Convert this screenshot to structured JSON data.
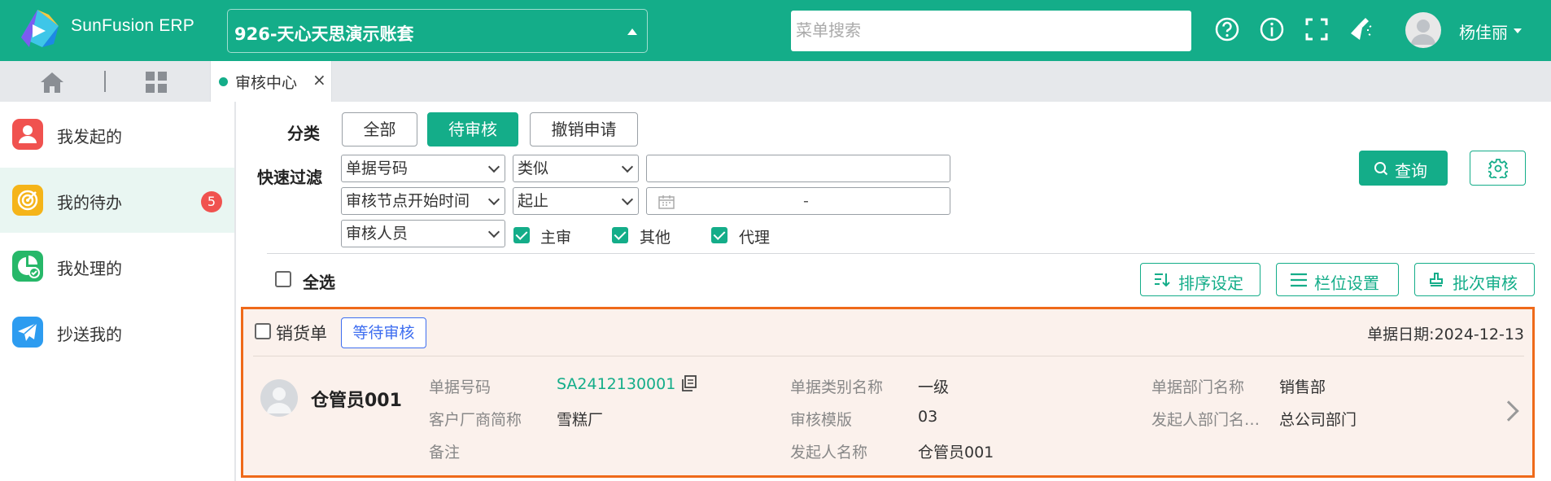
{
  "app": {
    "logo_text": "SunFusion ERP",
    "account": "926-天心天思演示账套",
    "search_placeholder": "菜单搜索",
    "user_name": "杨佳丽",
    "brand_color": "#14ad89"
  },
  "toolbar_icons": [
    "help-icon",
    "info-icon",
    "fullscreen-icon",
    "clean-icon"
  ],
  "tabs": {
    "home_icon": "home-icon",
    "grid_icon": "apps-grid-icon",
    "active_tab": "审核中心"
  },
  "sidebar": {
    "items": [
      {
        "label": "我发起的",
        "icon": "person-icon",
        "color": "#f0524f"
      },
      {
        "label": "我的待办",
        "icon": "target-icon",
        "color": "#f5b419",
        "badge": "5"
      },
      {
        "label": "我处理的",
        "icon": "chart-check-icon",
        "color": "#27b869"
      },
      {
        "label": "抄送我的",
        "icon": "send-icon",
        "color": "#2d9cf0"
      }
    ]
  },
  "filters": {
    "category_label": "分类",
    "categories": [
      "全部",
      "待审核",
      "撤销申请"
    ],
    "active_category": "待审核",
    "quick_label": "快速过滤",
    "row1": {
      "field": "单据号码",
      "op": "类似",
      "value": ""
    },
    "row2": {
      "field": "审核节点开始时间",
      "op": "起止",
      "range_sep": "-"
    },
    "row3": {
      "field": "审核人员"
    },
    "checkboxes": [
      {
        "label": "主审",
        "checked": true
      },
      {
        "label": "其他",
        "checked": true
      },
      {
        "label": "代理",
        "checked": true
      }
    ],
    "query_label": "查询"
  },
  "list_toolbar": {
    "select_all": "全选",
    "sort_label": "排序设定",
    "column_label": "栏位设置",
    "batch_label": "批次审核"
  },
  "card": {
    "doc_type": "销货单",
    "status": "等待审核",
    "doc_date": "单据日期:2024-12-13",
    "user": "仓管员001",
    "fields": {
      "doc_no_label": "单据号码",
      "doc_no": "SA2412130001",
      "customer_label": "客户厂商简称",
      "customer": "雪糕厂",
      "remark_label": "备注",
      "remark": "",
      "category_label": "单据类别名称",
      "category": "一级",
      "template_label": "审核模版",
      "template": "03",
      "initiator_label": "发起人名称",
      "initiator": "仓管员001",
      "dept_label": "单据部门名称",
      "dept": "销售部",
      "init_dept_label": "发起人部门名…",
      "init_dept": "总公司部门"
    }
  }
}
